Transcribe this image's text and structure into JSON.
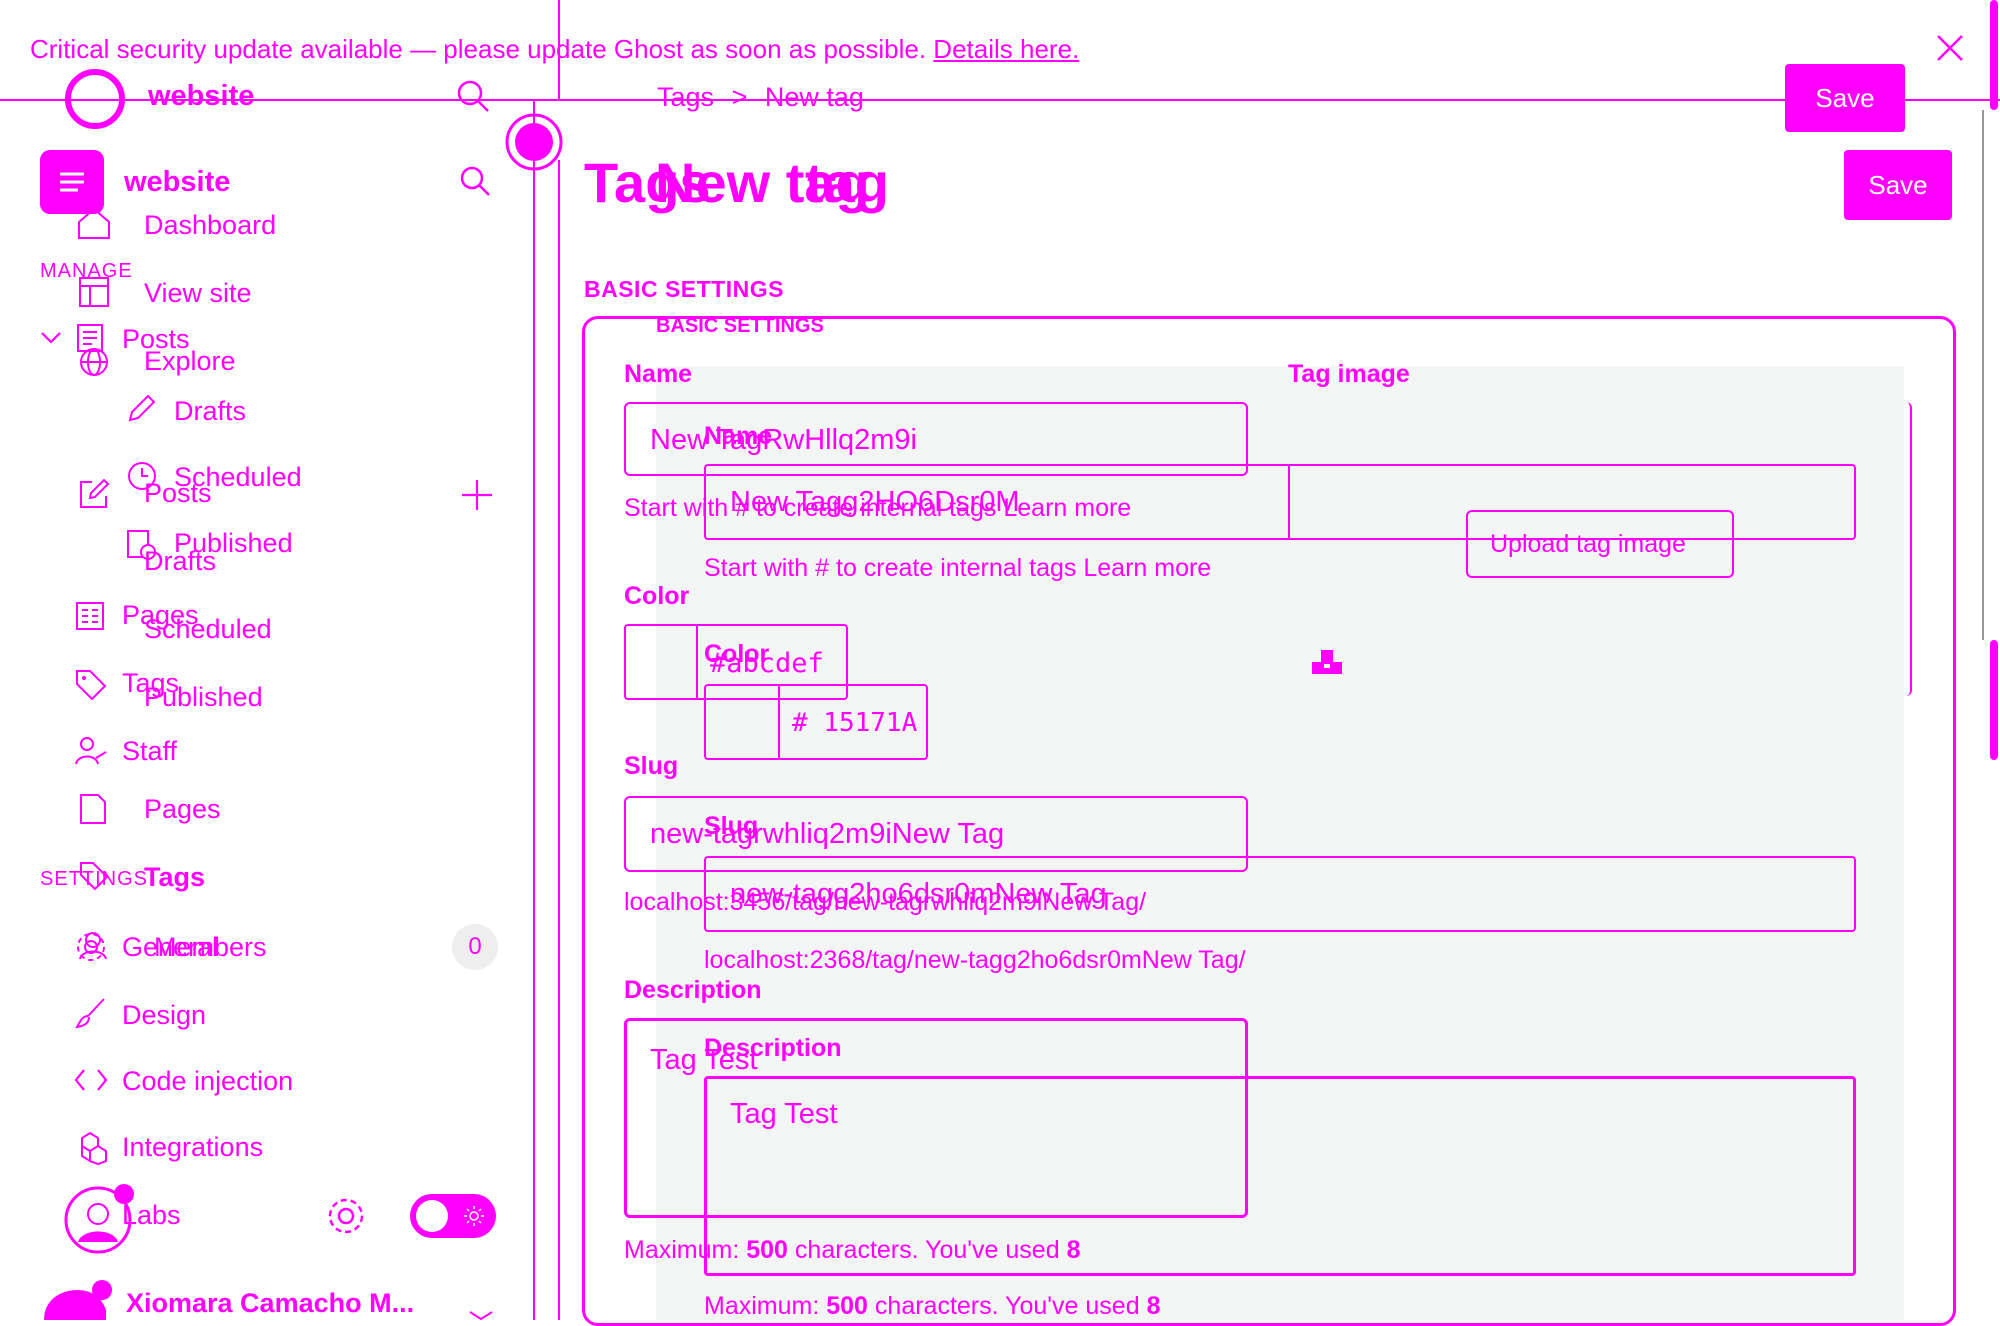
{
  "banner": {
    "text": "Critical security update available — please update Ghost as soon as possible.",
    "link": "Details here."
  },
  "brand": {
    "name": "website"
  },
  "breadcrumb": {
    "parent": "Tags",
    "separator": ">",
    "current": "New tag"
  },
  "toolbar": {
    "save_label": "Save"
  },
  "page_title": {
    "under": "Tags",
    "over": "New tag"
  },
  "sections": {
    "basic_settings": "BASIC SETTINGS"
  },
  "sidebar_a": {
    "manage_label": "MANAGE",
    "settings_label": "SETTINGS",
    "items": {
      "posts": "Posts",
      "drafts": "Drafts",
      "scheduled": "Scheduled",
      "published": "Published",
      "pages": "Pages",
      "tags": "Tags",
      "staff": "Staff",
      "general": "General",
      "design": "Design",
      "code_injection": "Code injection",
      "integrations": "Integrations",
      "labs": "Labs"
    }
  },
  "sidebar_b": {
    "items": {
      "dashboard": "Dashboard",
      "view_site": "View site",
      "explore": "Explore",
      "posts": "Posts",
      "drafts": "Drafts",
      "scheduled": "Scheduled",
      "published": "Published",
      "pages": "Pages",
      "tags": "Tags",
      "members": "Members",
      "members_count": "0"
    },
    "user_name": "Xiomara Camacho M..."
  },
  "form_a": {
    "name_label": "Name",
    "name_value": "New TagRwHllq2m9i",
    "name_help": "Start with # to create internal tags Learn more",
    "color_label": "Color",
    "color_value": "#abcdef",
    "slug_label": "Slug",
    "slug_value": "new-tagrwhliq2m9iNew Tag",
    "slug_url": "localhost:3456/tag/new-tagrwhliq2m9iNew Tag/",
    "description_label": "Description",
    "description_value": "Tag Test",
    "counter_prefix": "Maximum:",
    "counter_max": "500",
    "counter_mid": "characters. You've used",
    "counter_used": "8",
    "tag_image_label": "Tag image"
  },
  "form_b": {
    "name_label": "Name",
    "name_value": "New Tagg2HO6Dsr0M",
    "name_help": "Start with # to create internal tags Learn more",
    "color_label": "Color",
    "color_value": "# 15171A",
    "slug_label": "Slug",
    "slug_value": "new-tagg2ho6dsr0mNew Tag",
    "slug_url": "localhost:2368/tag/new-tagg2ho6dsr0mNew Tag/",
    "description_label": "Description",
    "description_value": "Tag Test",
    "counter_prefix": "Maximum:",
    "counter_max": "500",
    "counter_mid": "characters. You've used",
    "counter_used": "8",
    "upload_label": "Upload tag image"
  },
  "colors": {
    "accent": "#ff00ff",
    "panel": "#f4f5f5"
  }
}
